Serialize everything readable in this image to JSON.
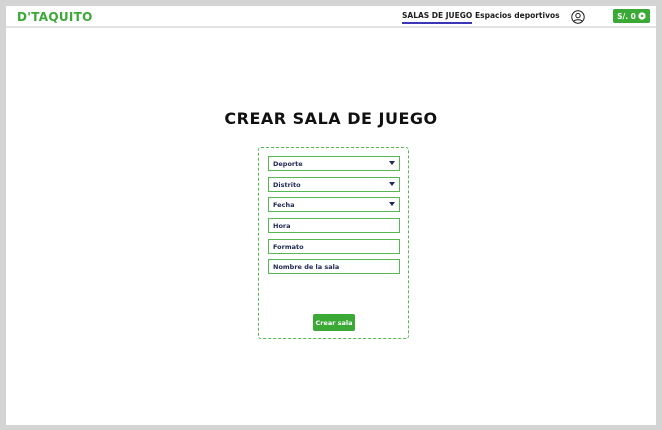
{
  "navbar": {
    "logo": "D'TAQUITO",
    "links": [
      {
        "label": "SALAS DE JUEGO",
        "active": true
      },
      {
        "label": "Espacios deportivos",
        "active": false
      }
    ],
    "wallet_label": "S/. 0",
    "user_icon": "user-circle-icon",
    "wallet_icon": "soccer-ball-icon"
  },
  "main": {
    "title": "CREAR SALA DE JUEGO",
    "fields": [
      {
        "label": "Deporte",
        "type": "select"
      },
      {
        "label": "Distrito",
        "type": "select"
      },
      {
        "label": "Fecha",
        "type": "select"
      },
      {
        "label": "Hora",
        "type": "input"
      },
      {
        "label": "Formato",
        "type": "input"
      },
      {
        "label": "Nombre de la sala",
        "type": "input"
      }
    ],
    "submit_label": "Crear sala"
  },
  "colors": {
    "accent": "#3aa935",
    "active_underline": "#3b36b5",
    "field_text": "#202a54",
    "background": "#d4d4d4"
  }
}
